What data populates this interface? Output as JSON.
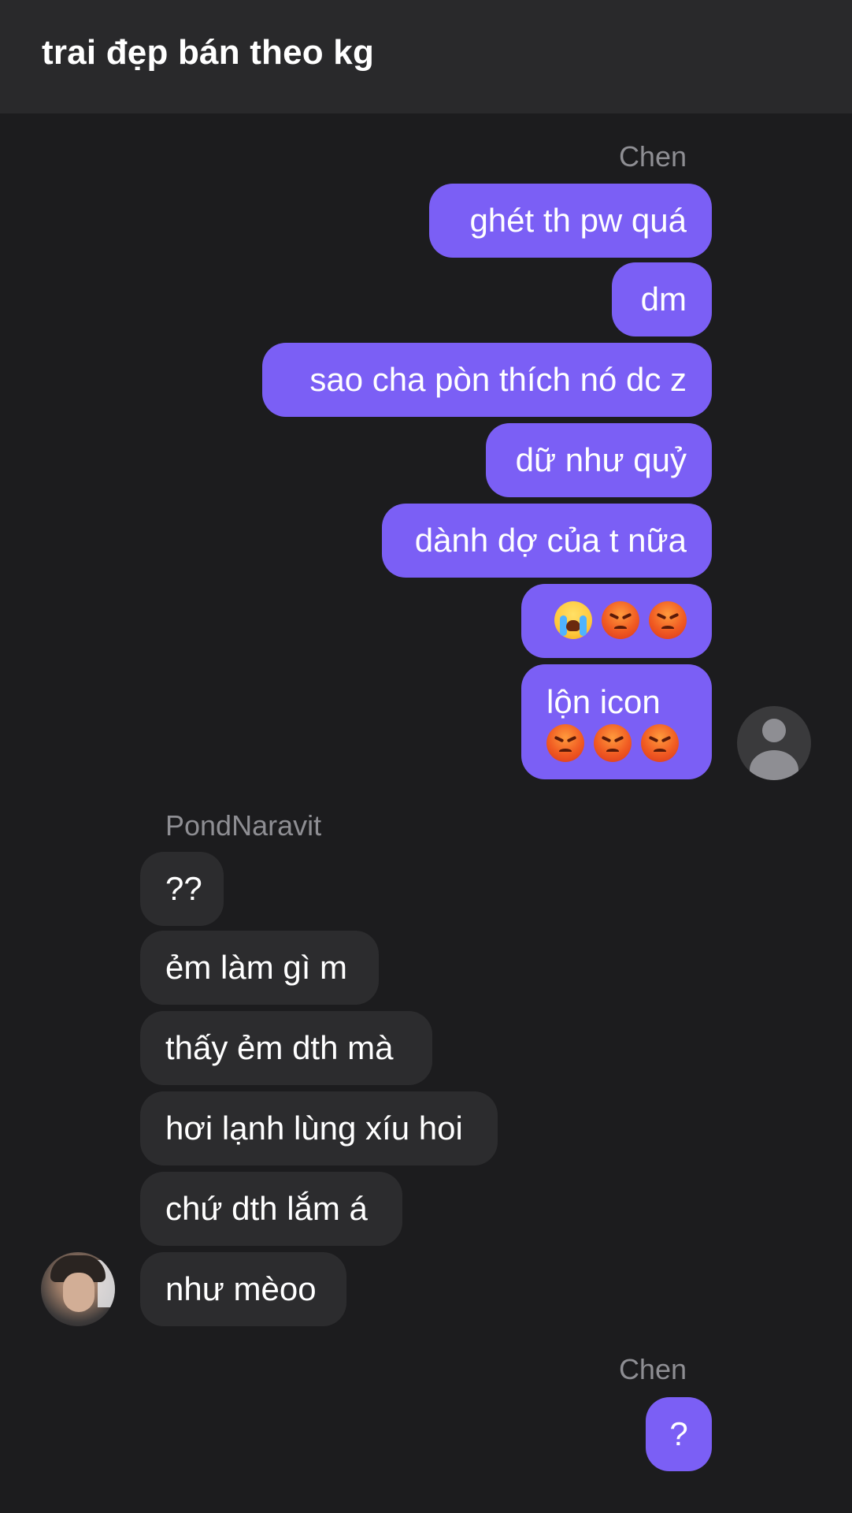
{
  "header": {
    "title": "trai đẹp bán theo kg"
  },
  "colors": {
    "header_bg": "#29292b",
    "page_bg": "#1c1c1e",
    "outgoing_bubble": "#7b5ff5",
    "incoming_bubble": "#2c2c2e",
    "sender_name": "#8e8e93"
  },
  "groups": [
    {
      "sender": "Chen",
      "direction": "outgoing",
      "avatar_icon": "default-user-avatar-icon",
      "messages": [
        "ghét th pw quá",
        "dm",
        "sao cha pòn thích nó dc z",
        "dữ như quỷ",
        "dành dợ của t nữa",
        "😭😡😡",
        "lộn icon 😡😡😡"
      ]
    },
    {
      "sender": "PondNaravit",
      "direction": "incoming",
      "avatar_icon": "profile-photo-avatar",
      "messages": [
        "??",
        "ẻm làm gì m",
        "thấy ẻm dth mà",
        "hơi lạnh lùng xíu hoi",
        "chứ dth lắm á",
        "như mèoo"
      ]
    },
    {
      "sender": "Chen",
      "direction": "outgoing",
      "messages": [
        "?"
      ]
    }
  ],
  "emoji": {
    "crying": "loudly-crying-face-icon",
    "angry": "pouting-face-icon"
  }
}
